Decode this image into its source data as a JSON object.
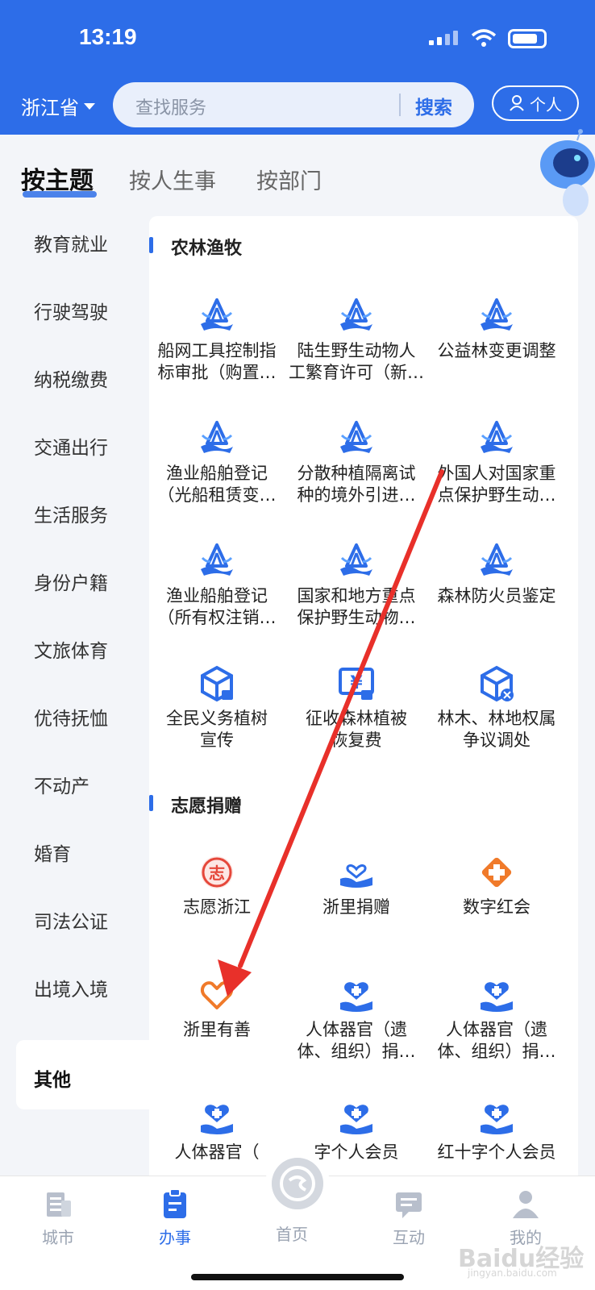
{
  "status_bar": {
    "time": "13:19"
  },
  "header": {
    "province": "浙江省",
    "search_placeholder": "查找服务",
    "search_button": "搜索",
    "personal_button": "个人"
  },
  "tabs": [
    {
      "label": "按主题",
      "active": true
    },
    {
      "label": "按人生事",
      "active": false
    },
    {
      "label": "按部门",
      "active": false
    }
  ],
  "sidebar": {
    "items": [
      "教育就业",
      "行驶驾驶",
      "纳税缴费",
      "交通出行",
      "生活服务",
      "身份户籍",
      "文旅体育",
      "优待抚恤",
      "不动产",
      "婚育",
      "司法公证",
      "出境入境",
      "其他"
    ],
    "active": "其他"
  },
  "sections": [
    {
      "title": "农林渔牧",
      "items": [
        {
          "lines": [
            "船网工具控制指",
            "标审批（购置…"
          ],
          "icon": "water-mountain-icon"
        },
        {
          "lines": [
            "陆生野生动物人",
            "工繁育许可（新…"
          ],
          "icon": "water-mountain-icon"
        },
        {
          "lines": [
            "公益林变更调整",
            ""
          ],
          "icon": "water-mountain-icon"
        },
        {
          "lines": [
            "渔业船舶登记",
            "（光船租赁变…"
          ],
          "icon": "water-mountain-icon"
        },
        {
          "lines": [
            "分散种植隔离试",
            "种的境外引进…"
          ],
          "icon": "water-mountain-icon"
        },
        {
          "lines": [
            "外国人对国家重",
            "点保护野生动…"
          ],
          "icon": "water-mountain-icon"
        },
        {
          "lines": [
            "渔业船舶登记",
            "（所有权注销…"
          ],
          "icon": "water-mountain-icon"
        },
        {
          "lines": [
            "国家和地方重点",
            "保护野生动物…"
          ],
          "icon": "water-mountain-icon"
        },
        {
          "lines": [
            "森林防火员鉴定",
            ""
          ],
          "icon": "water-mountain-icon"
        },
        {
          "lines": [
            "全民义务植树",
            "宣传"
          ],
          "icon": "cube-icon"
        },
        {
          "lines": [
            "征收森林植被",
            "恢复费"
          ],
          "icon": "yen-screen-icon"
        },
        {
          "lines": [
            "林木、林地权属",
            "争议调处"
          ],
          "icon": "cube-x-icon"
        }
      ]
    },
    {
      "title": "志愿捐赠",
      "items": [
        {
          "lines": [
            "志愿浙江",
            ""
          ],
          "icon": "volunteer-icon"
        },
        {
          "lines": [
            "浙里捐赠",
            ""
          ],
          "icon": "heart-hand-icon"
        },
        {
          "lines": [
            "数字红会",
            ""
          ],
          "icon": "red-cross-icon"
        },
        {
          "lines": [
            "浙里有善",
            ""
          ],
          "icon": "heart-outline-icon"
        },
        {
          "lines": [
            "人体器官（遗",
            "体、组织）捐…"
          ],
          "icon": "heart-cross-hand-icon"
        },
        {
          "lines": [
            "人体器官（遗",
            "体、组织）捐…"
          ],
          "icon": "heart-cross-hand-icon"
        },
        {
          "lines": [
            "人体器官（",
            ""
          ],
          "icon": "heart-cross-hand-icon"
        },
        {
          "lines": [
            "字个人会员",
            ""
          ],
          "icon": "heart-cross-hand-icon"
        },
        {
          "lines": [
            "红十字个人会员",
            ""
          ],
          "icon": "heart-cross-hand-icon"
        }
      ]
    }
  ],
  "bottom_nav": [
    {
      "label": "城市",
      "icon": "city-icon",
      "active": false
    },
    {
      "label": "办事",
      "icon": "clipboard-icon",
      "active": true
    },
    {
      "label": "首页",
      "icon": "home-logo-icon",
      "active": false
    },
    {
      "label": "互动",
      "icon": "chat-icon",
      "active": false
    },
    {
      "label": "我的",
      "icon": "user-icon",
      "active": false
    }
  ],
  "watermark": {
    "text": "Baidu经验",
    "subtext": "jingyan.baidu.com"
  },
  "colors": {
    "brand": "#2d6de8",
    "orange": "#f07a2a",
    "red_annotation": "#e8302a"
  }
}
